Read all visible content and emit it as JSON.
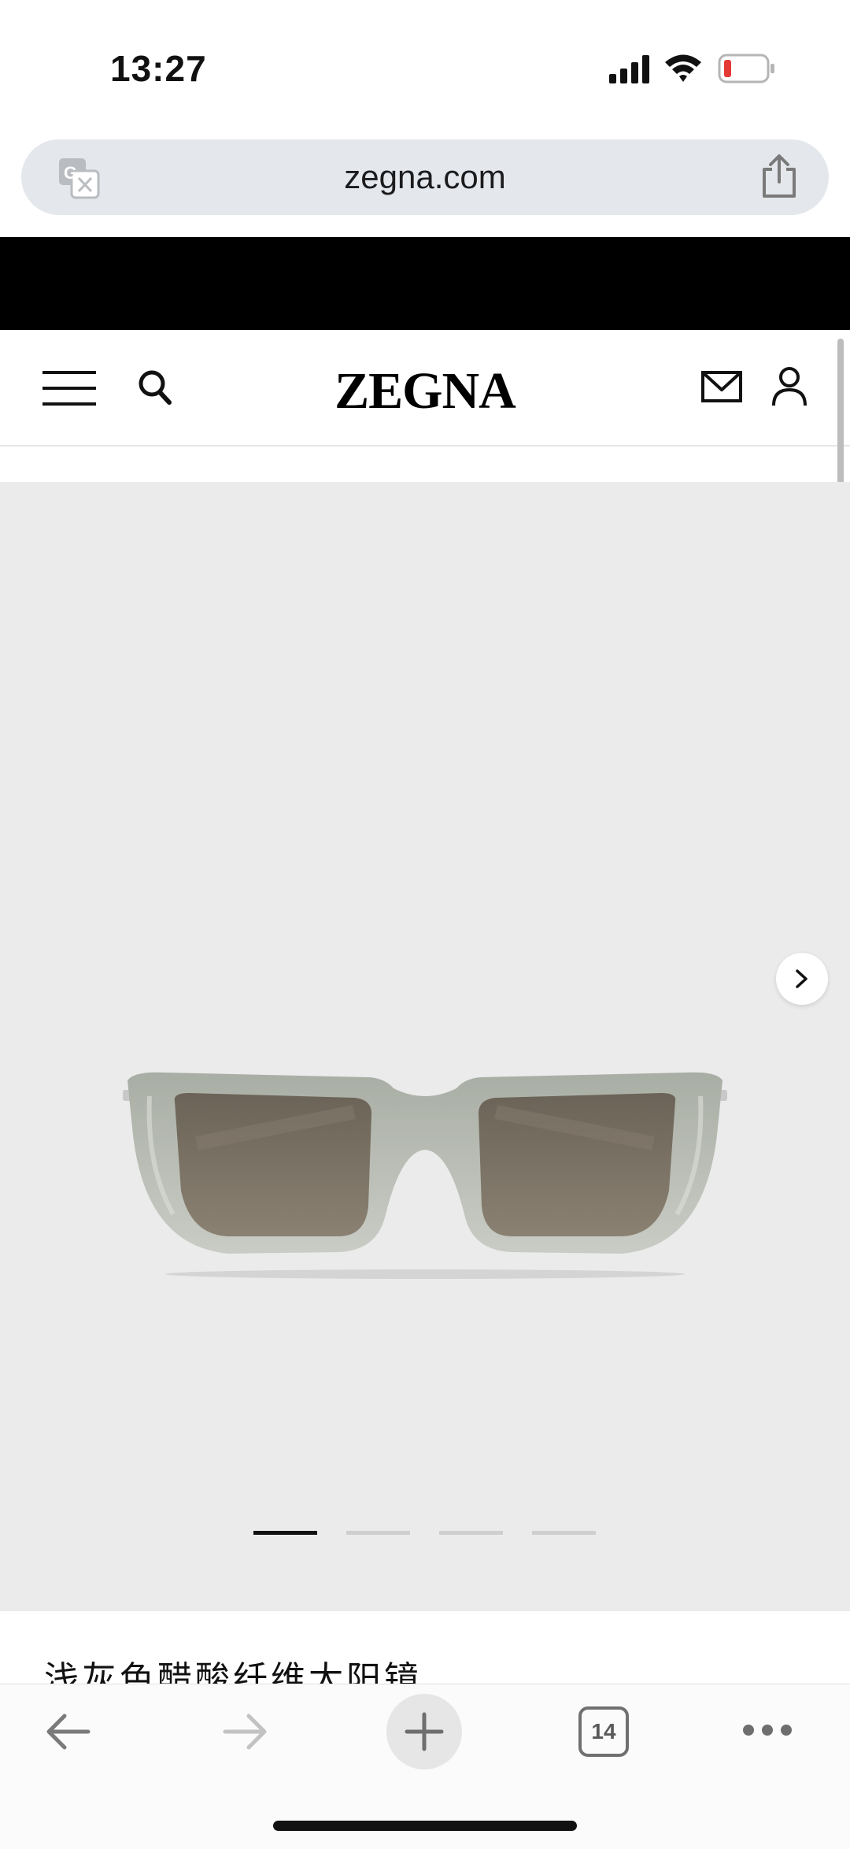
{
  "status_bar": {
    "time": "13:27",
    "icons": [
      "signal-icon",
      "wifi-icon",
      "battery-low-icon"
    ]
  },
  "browser": {
    "url": "zegna.com",
    "icons": [
      "translate-icon",
      "share-icon"
    ],
    "open_tabs_count": "14",
    "toolbar_icons": [
      "back-icon",
      "forward-icon",
      "plus-icon",
      "tabs-icon",
      "more-icon"
    ]
  },
  "header": {
    "brand": "ZEGNA",
    "icons": [
      "menu-icon",
      "search-icon",
      "mail-icon",
      "account-icon"
    ]
  },
  "gallery": {
    "image_count": 4,
    "active_index": 0,
    "next_icon": "chevron-right-icon",
    "image_subject": "sunglasses"
  },
  "product": {
    "title": "浅灰色醋酸纤维太阳镜"
  },
  "colors": {
    "banner": "#000000",
    "gallery_bg": "#ebebeb",
    "url_bar_bg": "#e4e7eb",
    "battery_low": "#e53935"
  }
}
